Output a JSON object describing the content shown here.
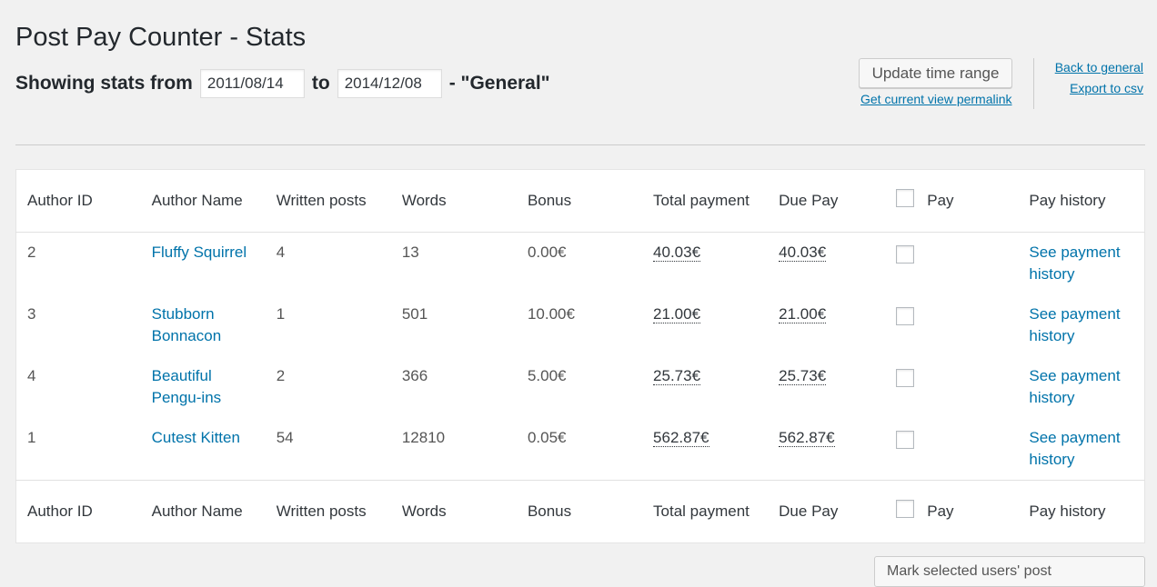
{
  "header": {
    "title": "Post Pay Counter - Stats",
    "showing_from": "Showing stats from",
    "date_from": "2011/08/14",
    "to_label": "to",
    "date_to": "2014/12/08",
    "view_label": "- \"General\""
  },
  "actions": {
    "update_button": "Update time range",
    "permalink": "Get current view permalink",
    "back_link": "Back to general",
    "export_link": "Export to csv",
    "mark_button": "Mark selected users' post"
  },
  "table": {
    "columns": [
      "Author ID",
      "Author Name",
      "Written posts",
      "Words",
      "Bonus",
      "Total payment",
      "Due Pay",
      "Pay",
      "Pay history"
    ],
    "rows": [
      {
        "id": "2",
        "name": "Fluffy Squirrel",
        "posts": "4",
        "words": "13",
        "bonus": "0.00€",
        "total": "40.03€",
        "due": "40.03€",
        "history": "See payment history"
      },
      {
        "id": "3",
        "name": "Stubborn Bonnacon",
        "posts": "1",
        "words": "501",
        "bonus": "10.00€",
        "total": "21.00€",
        "due": "21.00€",
        "history": "See payment history"
      },
      {
        "id": "4",
        "name": "Beautiful Pengu-ins",
        "posts": "2",
        "words": "366",
        "bonus": "5.00€",
        "total": "25.73€",
        "due": "25.73€",
        "history": "See payment history"
      },
      {
        "id": "1",
        "name": "Cutest Kitten",
        "posts": "54",
        "words": "12810",
        "bonus": "0.05€",
        "total": "562.87€",
        "due": "562.87€",
        "history": "See payment history"
      }
    ]
  }
}
